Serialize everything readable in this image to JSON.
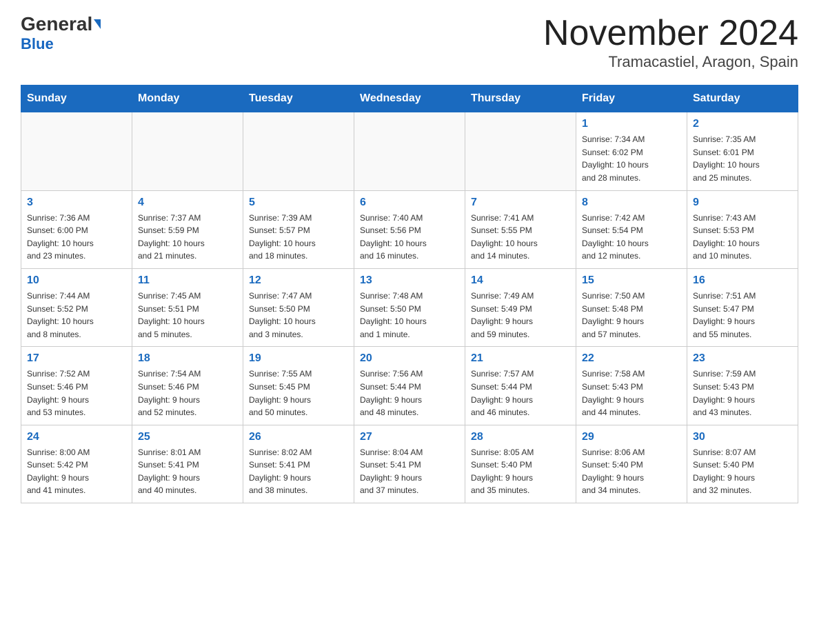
{
  "header": {
    "logo_general": "General",
    "logo_blue": "Blue",
    "month_title": "November 2024",
    "location": "Tramacastiel, Aragon, Spain"
  },
  "weekdays": [
    "Sunday",
    "Monday",
    "Tuesday",
    "Wednesday",
    "Thursday",
    "Friday",
    "Saturday"
  ],
  "weeks": [
    [
      {
        "day": "",
        "info": ""
      },
      {
        "day": "",
        "info": ""
      },
      {
        "day": "",
        "info": ""
      },
      {
        "day": "",
        "info": ""
      },
      {
        "day": "",
        "info": ""
      },
      {
        "day": "1",
        "info": "Sunrise: 7:34 AM\nSunset: 6:02 PM\nDaylight: 10 hours\nand 28 minutes."
      },
      {
        "day": "2",
        "info": "Sunrise: 7:35 AM\nSunset: 6:01 PM\nDaylight: 10 hours\nand 25 minutes."
      }
    ],
    [
      {
        "day": "3",
        "info": "Sunrise: 7:36 AM\nSunset: 6:00 PM\nDaylight: 10 hours\nand 23 minutes."
      },
      {
        "day": "4",
        "info": "Sunrise: 7:37 AM\nSunset: 5:59 PM\nDaylight: 10 hours\nand 21 minutes."
      },
      {
        "day": "5",
        "info": "Sunrise: 7:39 AM\nSunset: 5:57 PM\nDaylight: 10 hours\nand 18 minutes."
      },
      {
        "day": "6",
        "info": "Sunrise: 7:40 AM\nSunset: 5:56 PM\nDaylight: 10 hours\nand 16 minutes."
      },
      {
        "day": "7",
        "info": "Sunrise: 7:41 AM\nSunset: 5:55 PM\nDaylight: 10 hours\nand 14 minutes."
      },
      {
        "day": "8",
        "info": "Sunrise: 7:42 AM\nSunset: 5:54 PM\nDaylight: 10 hours\nand 12 minutes."
      },
      {
        "day": "9",
        "info": "Sunrise: 7:43 AM\nSunset: 5:53 PM\nDaylight: 10 hours\nand 10 minutes."
      }
    ],
    [
      {
        "day": "10",
        "info": "Sunrise: 7:44 AM\nSunset: 5:52 PM\nDaylight: 10 hours\nand 8 minutes."
      },
      {
        "day": "11",
        "info": "Sunrise: 7:45 AM\nSunset: 5:51 PM\nDaylight: 10 hours\nand 5 minutes."
      },
      {
        "day": "12",
        "info": "Sunrise: 7:47 AM\nSunset: 5:50 PM\nDaylight: 10 hours\nand 3 minutes."
      },
      {
        "day": "13",
        "info": "Sunrise: 7:48 AM\nSunset: 5:50 PM\nDaylight: 10 hours\nand 1 minute."
      },
      {
        "day": "14",
        "info": "Sunrise: 7:49 AM\nSunset: 5:49 PM\nDaylight: 9 hours\nand 59 minutes."
      },
      {
        "day": "15",
        "info": "Sunrise: 7:50 AM\nSunset: 5:48 PM\nDaylight: 9 hours\nand 57 minutes."
      },
      {
        "day": "16",
        "info": "Sunrise: 7:51 AM\nSunset: 5:47 PM\nDaylight: 9 hours\nand 55 minutes."
      }
    ],
    [
      {
        "day": "17",
        "info": "Sunrise: 7:52 AM\nSunset: 5:46 PM\nDaylight: 9 hours\nand 53 minutes."
      },
      {
        "day": "18",
        "info": "Sunrise: 7:54 AM\nSunset: 5:46 PM\nDaylight: 9 hours\nand 52 minutes."
      },
      {
        "day": "19",
        "info": "Sunrise: 7:55 AM\nSunset: 5:45 PM\nDaylight: 9 hours\nand 50 minutes."
      },
      {
        "day": "20",
        "info": "Sunrise: 7:56 AM\nSunset: 5:44 PM\nDaylight: 9 hours\nand 48 minutes."
      },
      {
        "day": "21",
        "info": "Sunrise: 7:57 AM\nSunset: 5:44 PM\nDaylight: 9 hours\nand 46 minutes."
      },
      {
        "day": "22",
        "info": "Sunrise: 7:58 AM\nSunset: 5:43 PM\nDaylight: 9 hours\nand 44 minutes."
      },
      {
        "day": "23",
        "info": "Sunrise: 7:59 AM\nSunset: 5:43 PM\nDaylight: 9 hours\nand 43 minutes."
      }
    ],
    [
      {
        "day": "24",
        "info": "Sunrise: 8:00 AM\nSunset: 5:42 PM\nDaylight: 9 hours\nand 41 minutes."
      },
      {
        "day": "25",
        "info": "Sunrise: 8:01 AM\nSunset: 5:41 PM\nDaylight: 9 hours\nand 40 minutes."
      },
      {
        "day": "26",
        "info": "Sunrise: 8:02 AM\nSunset: 5:41 PM\nDaylight: 9 hours\nand 38 minutes."
      },
      {
        "day": "27",
        "info": "Sunrise: 8:04 AM\nSunset: 5:41 PM\nDaylight: 9 hours\nand 37 minutes."
      },
      {
        "day": "28",
        "info": "Sunrise: 8:05 AM\nSunset: 5:40 PM\nDaylight: 9 hours\nand 35 minutes."
      },
      {
        "day": "29",
        "info": "Sunrise: 8:06 AM\nSunset: 5:40 PM\nDaylight: 9 hours\nand 34 minutes."
      },
      {
        "day": "30",
        "info": "Sunrise: 8:07 AM\nSunset: 5:40 PM\nDaylight: 9 hours\nand 32 minutes."
      }
    ]
  ]
}
